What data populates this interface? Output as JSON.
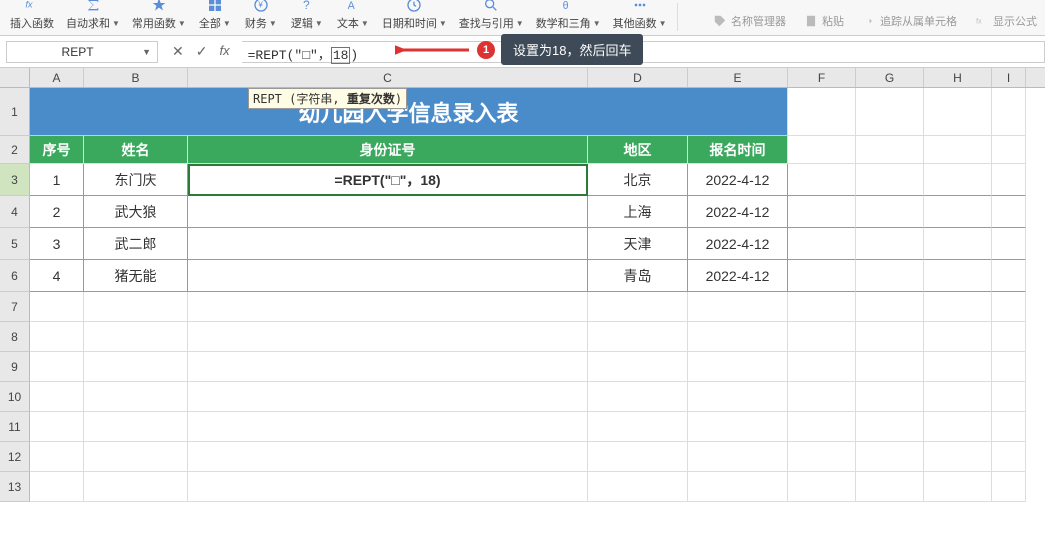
{
  "toolbar": {
    "insert_fn": "插入函数",
    "autosum": "自动求和",
    "common": "常用函数",
    "all": "全部",
    "financial": "财务",
    "logical": "逻辑",
    "text": "文本",
    "datetime": "日期和时间",
    "lookup": "查找与引用",
    "math": "数学和三角",
    "other": "其他函数",
    "name_mgr": "名称管理器",
    "paste": "粘贴",
    "trace": "追踪从属单元格",
    "show_formula": "显示公式"
  },
  "namebox": "REPT",
  "formula": {
    "prefix": "=REPT(\"□\"，",
    "highlight": "18",
    "suffix": ")"
  },
  "func_hint": {
    "name": "REPT",
    "args_prefix": " (字符串, ",
    "args_bold": "重复次数",
    "args_suffix": ")"
  },
  "callout": {
    "num": "1",
    "text": "设置为18，然后回车"
  },
  "columns": [
    "A",
    "B",
    "C",
    "D",
    "E",
    "F",
    "G",
    "H",
    "I"
  ],
  "row_labels": [
    "1",
    "2",
    "3",
    "4",
    "5",
    "6",
    "7",
    "8",
    "9",
    "10",
    "11",
    "12",
    "13"
  ],
  "sheet": {
    "title": "幼儿园入学信息录入表",
    "headers": {
      "seq": "序号",
      "name": "姓名",
      "id": "身份证号",
      "region": "地区",
      "date": "报名时间"
    },
    "rows": [
      {
        "seq": "1",
        "name": "东门庆",
        "id_display": "=REPT(\"□\"，18)",
        "region": "北京",
        "date": "2022-4-12"
      },
      {
        "seq": "2",
        "name": "武大狼",
        "id_display": "",
        "region": "上海",
        "date": "2022-4-12"
      },
      {
        "seq": "3",
        "name": "武二郎",
        "id_display": "",
        "region": "天津",
        "date": "2022-4-12"
      },
      {
        "seq": "4",
        "name": "猪无能",
        "id_display": "",
        "region": "青岛",
        "date": "2022-4-12"
      }
    ]
  }
}
